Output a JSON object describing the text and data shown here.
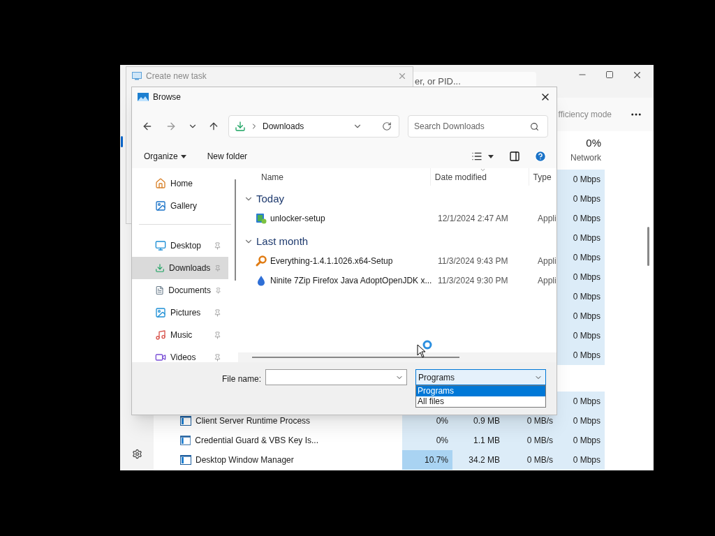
{
  "task_manager": {
    "search_text": "er, or PID...",
    "toolbar_text": "fficiency mode",
    "network_header": {
      "percent": "0%",
      "label": "Network"
    },
    "rows": [
      {
        "kind": "process",
        "network": "0 Mbps"
      },
      {
        "kind": "process",
        "network": "0 Mbps"
      },
      {
        "kind": "process",
        "network": "0 Mbps"
      },
      {
        "kind": "process",
        "network": "0 Mbps"
      },
      {
        "kind": "process",
        "network": "0 Mbps"
      },
      {
        "kind": "process",
        "network": "0 Mbps"
      },
      {
        "kind": "process",
        "network": "0 Mbps"
      },
      {
        "kind": "process",
        "network": "0 Mbps"
      },
      {
        "kind": "process",
        "network": "0 Mbps"
      },
      {
        "kind": "process",
        "network": "0 Mbps"
      },
      {
        "kind": "group"
      },
      {
        "kind": "process",
        "network": "0 Mbps"
      },
      {
        "kind": "process",
        "name": "Client Server Runtime Process",
        "cpu": "0%",
        "memory": "0.9 MB",
        "disk": "0 MB/s",
        "network": "0 Mbps",
        "cpu_busy": false
      },
      {
        "kind": "process",
        "name": "Credential Guard & VBS Key Is...",
        "cpu": "0%",
        "memory": "1.1 MB",
        "disk": "0 MB/s",
        "network": "0 Mbps",
        "cpu_busy": false
      },
      {
        "kind": "process",
        "name": "Desktop Window Manager",
        "cpu": "10.7%",
        "memory": "34.2 MB",
        "disk": "0 MB/s",
        "network": "0 Mbps",
        "cpu_busy": true
      }
    ]
  },
  "create_task": {
    "title": "Create new task"
  },
  "browse": {
    "title": "Browse",
    "address": "Downloads",
    "search_placeholder": "Search Downloads",
    "toolbar": [
      "Organize",
      "New folder"
    ],
    "sidebar": [
      [
        {
          "label": "Home",
          "pinned": false,
          "selected": false
        },
        {
          "label": "Gallery",
          "pinned": false,
          "selected": false
        }
      ],
      [
        {
          "label": "Desktop",
          "pinned": true,
          "selected": false
        },
        {
          "label": "Downloads",
          "pinned": true,
          "selected": true
        },
        {
          "label": "Documents",
          "pinned": true,
          "selected": false
        },
        {
          "label": "Pictures",
          "pinned": true,
          "selected": false
        },
        {
          "label": "Music",
          "pinned": true,
          "selected": false
        },
        {
          "label": "Videos",
          "pinned": true,
          "selected": false
        }
      ]
    ],
    "columns": [
      {
        "label": "Name",
        "sorted": false
      },
      {
        "label": "Date modified",
        "sorted": true
      },
      {
        "label": "Type",
        "sorted": false
      }
    ],
    "groups": [
      {
        "label": "Today",
        "expanded": true,
        "files": [
          {
            "name": "unlocker-setup",
            "date": "12/1/2024 2:47 AM",
            "type": "Appli"
          }
        ]
      },
      {
        "label": "Last month",
        "expanded": true,
        "files": [
          {
            "name": "Everything-1.4.1.1026.x64-Setup",
            "date": "11/3/2024 9:43 PM",
            "type": "Appli"
          },
          {
            "name": "Ninite 7Zip Firefox Java AdoptOpenJDK x...",
            "date": "11/3/2024 9:30 PM",
            "type": "Appli"
          }
        ]
      }
    ],
    "file_name_label": "File name:",
    "filter": {
      "value": "Programs",
      "options": [
        {
          "label": "Programs",
          "selected": true
        },
        {
          "label": "All files",
          "selected": false
        }
      ]
    }
  }
}
